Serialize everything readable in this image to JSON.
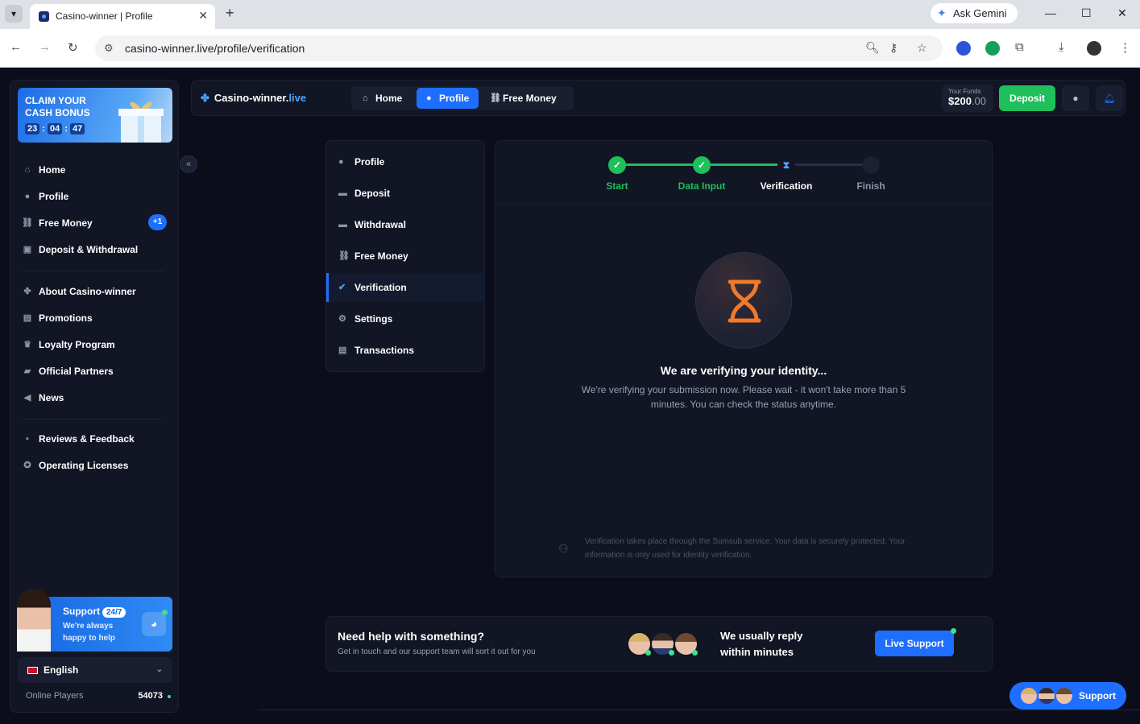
{
  "browser": {
    "tab_title": "Casino-winner | Profile",
    "url": "casino-winner.live/profile/verification",
    "gemini_label": "Ask Gemini"
  },
  "sidebar": {
    "bonus": {
      "title": "CLAIM YOUR CASH BONUS",
      "h": "23",
      "m": "04",
      "s": "47"
    },
    "items_main": [
      {
        "label": "Home",
        "icon": "home-icon"
      },
      {
        "label": "Profile",
        "icon": "user-icon"
      },
      {
        "label": "Free Money",
        "icon": "gift-icon",
        "badge": "+1"
      },
      {
        "label": "Deposit & Withdrawal",
        "icon": "wallet-icon"
      }
    ],
    "items_info": [
      {
        "label": "About Casino-winner",
        "icon": "clover-icon"
      },
      {
        "label": "Promotions",
        "icon": "gift-box-icon"
      },
      {
        "label": "Loyalty Program",
        "icon": "trophy-icon"
      },
      {
        "label": "Official Partners",
        "icon": "briefcase-icon"
      },
      {
        "label": "News",
        "icon": "megaphone-icon"
      }
    ],
    "items_extra": [
      {
        "label": "Reviews & Feedback",
        "icon": "comment-icon"
      },
      {
        "label": "Operating Licenses",
        "icon": "badge-icon"
      }
    ],
    "support": {
      "title": "Support",
      "badge": "24/7",
      "subtitle": "We're always happy to help"
    },
    "language": "English",
    "online_label": "Online Players",
    "online_count": "54073"
  },
  "topbar": {
    "logo_main": "Casino-winner.",
    "logo_accent": "live",
    "nav": [
      "Home",
      "Profile",
      "Free Money"
    ],
    "funds_label": "Your Funds",
    "funds_value": "$200",
    "funds_cents": ".00",
    "deposit": "Deposit"
  },
  "profile_menu": [
    "Profile",
    "Deposit",
    "Withdrawal",
    "Free Money",
    "Verification",
    "Settings",
    "Transactions"
  ],
  "verification": {
    "steps": [
      "Start",
      "Data Input",
      "Verification",
      "Finish"
    ],
    "title": "We are verifying your identity...",
    "desc": "We're verifying your submission now. Please wait - it won't take more than 5 minutes. You can check the status anytime.",
    "note": "Verification takes place through the Sumsub service. Your data is securely protected. Your information is only used for identity verification."
  },
  "help": {
    "title": "Need help with something?",
    "subtitle": "Get in touch and our support team will sort it out for you",
    "reply": "We usually reply within minutes",
    "button": "Live Support"
  },
  "floating_support": "Support",
  "colors": {
    "accent": "#1e6fff",
    "success": "#1fbf5c",
    "bg": "#0b0e1a",
    "panel": "#111524"
  }
}
